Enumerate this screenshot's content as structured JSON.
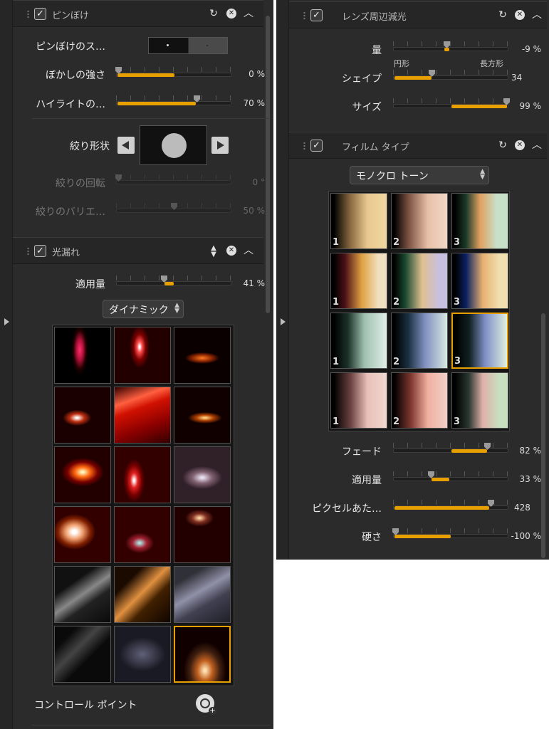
{
  "left": {
    "bokeh": {
      "title": "ピンぼけ",
      "scale_label": "ピンぼけのス…",
      "blur_label": "ぼかしの強さ",
      "blur_value": "0 %",
      "blur_level": 0.5,
      "highlight_label": "ハイライトの…",
      "highlight_value": "70 %",
      "highlight_level": 0.7,
      "shape_label": "絞り形状",
      "rotation_label": "絞りの回転",
      "rotation_value": "0 °",
      "variation_label": "絞りのバリエ…",
      "variation_value": "50 %"
    },
    "flare": {
      "title": "光漏れ",
      "amount_label": "適用量",
      "amount_value": "41 %",
      "amount_level": 0.41,
      "preset": "ダイナミック",
      "control_point_label": "コントロール ポイント"
    }
  },
  "right": {
    "vignette": {
      "title": "レンズ周辺減光",
      "amount_label": "量",
      "amount_value": "-9 %",
      "shape_label": "シェイプ",
      "shape_min": "円形",
      "shape_max": "長方形",
      "shape_value": "34",
      "size_label": "サイズ",
      "size_value": "99 %"
    },
    "film": {
      "title": "フィルム タイプ",
      "preset": "モノクロ トーン",
      "fade_label": "フェード",
      "fade_value": "82 %",
      "amount_label": "適用量",
      "amount_value": "33 %",
      "pixel_label": "ピクセルあた…",
      "pixel_value": "428",
      "hardness_label": "硬さ",
      "hardness_value": "-100 %",
      "tile_numbers": [
        "1",
        "2",
        "3",
        "1",
        "2",
        "3",
        "1",
        "2",
        "3",
        "1",
        "2",
        "3"
      ]
    }
  },
  "colors": {
    "accent": "#e8a000",
    "panel": "#2b2b2b",
    "header": "#262626"
  }
}
